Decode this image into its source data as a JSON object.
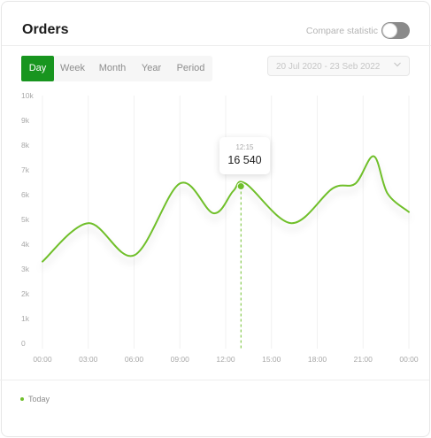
{
  "header": {
    "title": "Orders",
    "compare_label": "Compare statistic",
    "compare_enabled": false
  },
  "tabs": [
    "Day",
    "Week",
    "Month",
    "Year",
    "Period"
  ],
  "active_tab": "Day",
  "date_range": "20 Jul 2020 - 23 Seb 2022",
  "tooltip": {
    "time": "12:15",
    "value": "16 540"
  },
  "legend": [
    {
      "label": "Today",
      "color": "#6fbf2b"
    }
  ],
  "colors": {
    "accent": "#18951f",
    "line": "#6fbf2b"
  },
  "icons": {
    "date_range": "chevron-down-icon"
  },
  "chart_data": {
    "type": "line",
    "x_tick_labels": [
      "00:00",
      "03:00",
      "06:00",
      "09:00",
      "12:00",
      "15:00",
      "18:00",
      "21:00",
      "00:00"
    ],
    "y_tick_labels": [
      "0",
      "1k",
      "2k",
      "3k",
      "4k",
      "5k",
      "6k",
      "7k",
      "8k",
      "9k",
      "10k"
    ],
    "ylim": [
      0,
      10000
    ],
    "xlim_hours": [
      0,
      24
    ],
    "grid": "vertical",
    "series": [
      {
        "name": "Today",
        "x_hours": [
          0,
          3,
          6,
          9,
          11.2,
          12.5,
          13.3,
          16.3,
          19,
          20.5,
          21.7,
          22.6,
          24
        ],
        "values": [
          3300,
          4850,
          3550,
          6450,
          5250,
          6150,
          6450,
          4850,
          6250,
          6450,
          7550,
          6050,
          5300
        ]
      }
    ],
    "highlight": {
      "x_hours": 13,
      "label": "12:15"
    }
  }
}
